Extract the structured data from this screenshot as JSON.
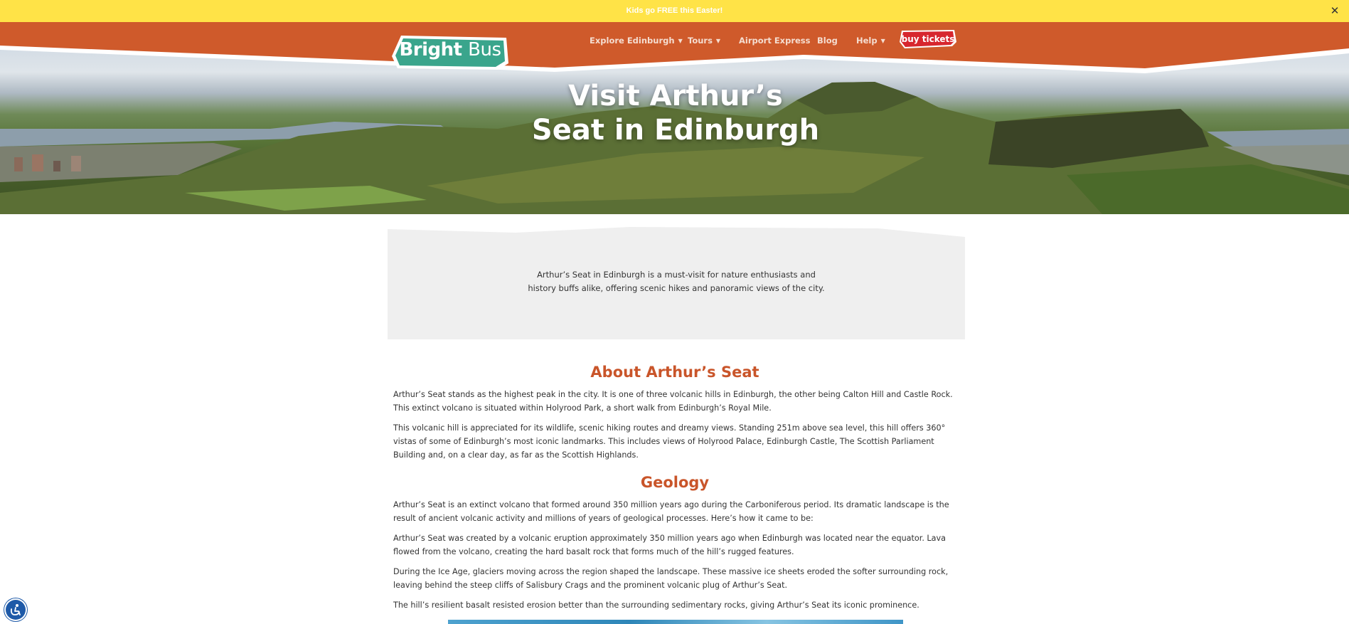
{
  "announcement": {
    "text": "Kids go FREE this Easter!",
    "close_icon": "close-icon"
  },
  "header": {
    "logo": {
      "bright": "Bright",
      "bus": "Bus"
    },
    "nav": [
      {
        "label": "Explore Edinburgh",
        "has_dropdown": true
      },
      {
        "label": "Tours",
        "has_dropdown": true
      },
      {
        "label": "Airport Express",
        "has_dropdown": false
      },
      {
        "label": "Blog",
        "has_dropdown": false
      },
      {
        "label": "Help",
        "has_dropdown": true
      }
    ],
    "buy_tickets": "buy tickets"
  },
  "hero": {
    "title_line1": "Visit Arthur’s",
    "title_line2": "Seat in Edinburgh"
  },
  "intro": {
    "line1": "Arthur’s Seat in Edinburgh is a must-visit for nature enthusiasts and",
    "line2": "history buffs alike, offering scenic hikes and panoramic views of the city."
  },
  "sections": [
    {
      "heading": "About Arthur’s Seat",
      "paragraphs": [
        "Arthur’s Seat stands as the highest peak in the city. It is one of three volcanic hills in Edinburgh, the other being Calton Hill and Castle Rock. This extinct volcano is situated within Holyrood Park, a short walk from Edinburgh’s Royal Mile.",
        "This volcanic hill is appreciated for its wildlife, scenic hiking routes and dreamy views. Standing 251m above sea level, this hill offers 360° vistas of some of Edinburgh’s most iconic landmarks. This includes views of Holyrood Palace, Edinburgh Castle, The Scottish Parliament Building and, on a clear day, as far as the Scottish Highlands."
      ]
    },
    {
      "heading": "Geology",
      "paragraphs": [
        "Arthur’s Seat is an extinct volcano that formed around 350 million years ago during the Carboniferous period. Its dramatic landscape is the result of ancient volcanic activity and millions of years of geological processes. Here’s how it came to be:",
        "Arthur’s Seat was created by a volcanic eruption approximately 350 million years ago when Edinburgh was located near the equator. Lava flowed from the volcano, creating the hard basalt rock that forms much of the hill’s rugged features.",
        "During the Ice Age, glaciers moving across the region shaped the landscape. These massive ice sheets eroded the softer surrounding rock, leaving behind the steep cliffs of Salisbury Crags and the prominent volcanic plug of Arthur’s Seat.",
        "The hill’s resilient basalt resisted erosion better than the surrounding sedimentary rocks, giving Arthur’s Seat its iconic prominence."
      ]
    }
  ],
  "colors": {
    "announcement_bg": "#ffe347",
    "header_bg": "#cf5a2b",
    "heading": "#c9552a",
    "button_red": "#d7262e",
    "logo_green": "#3aa58c",
    "intro_bg": "#efefef",
    "a11y_blue": "#1e5aa8"
  },
  "icons": {
    "accessibility": "accessibility-icon",
    "dropdown": "chevron-down-icon"
  }
}
